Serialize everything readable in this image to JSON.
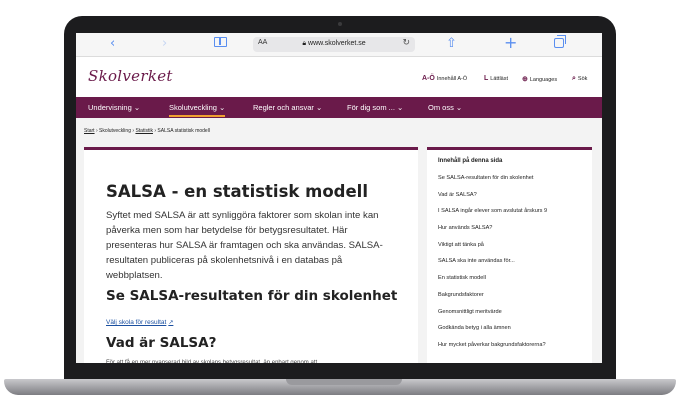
{
  "browser": {
    "aa_label": "AA",
    "url": "www.skolverket.se",
    "icons": [
      "back-icon",
      "forward-icon",
      "bookmarks-icon",
      "lock-icon",
      "reload-icon",
      "share-icon",
      "new-tab-icon",
      "tabs-icon"
    ]
  },
  "site": {
    "logo": "Skolverket",
    "utility_links": [
      {
        "icon": "A-Ö",
        "label": "Innehåll A-Ö"
      },
      {
        "icon": "L",
        "label": "Lättläst"
      },
      {
        "icon": "⊕",
        "label": "Languages"
      },
      {
        "icon": "⌕",
        "label": "Sök"
      }
    ]
  },
  "nav": {
    "items": [
      "Undervisning ⌄",
      "Skolutveckling ⌄",
      "Regler och ansvar ⌄",
      "För dig som ... ⌄",
      "Om oss ⌄"
    ],
    "active_index": 1,
    "accent_color": "#6a1a4a",
    "active_underline_color": "#f0a030"
  },
  "breadcrumb": {
    "start": "Start",
    "sep": " › ",
    "p1": "Skolutveckling",
    "p2": "Statistik",
    "p3": "SALSA statistisk modell"
  },
  "article": {
    "title": "SALSA - en statistisk modell",
    "lead": "Syftet med SALSA är att synliggöra faktorer som skolan inte kan påverka men som har betydelse för betygsresultatet. Här presenteras hur SALSA är framtagen och ska användas. SALSA-resultaten publiceras på skolenhetsnivå i en databas på webbplatsen.",
    "h2": "Se SALSA-resultaten för din skolenhet",
    "link": "Välj skola för resultat",
    "h3": "Vad är SALSA?",
    "cut_text": "För att få en mer nyanserad bild av skolans betygsresultat, än enbart genom att"
  },
  "toc": {
    "title": "Innehåll på denna sida",
    "items": [
      "Se SALSA-resultaten för din skolenhet",
      "Vad är SALSA?",
      "I SALSA ingår elever som avslutat årskurs 9",
      "Hur används SALSA?",
      "Viktigt att tänka på",
      "SALSA ska inte användas för...",
      "En statistisk modell",
      "Bakgrundsfaktorer",
      "Genomsnittligt meritvärde",
      "Godkända betyg i alla ämnen",
      "Hur mycket påverkar bakgrundsfaktorerna?"
    ]
  }
}
